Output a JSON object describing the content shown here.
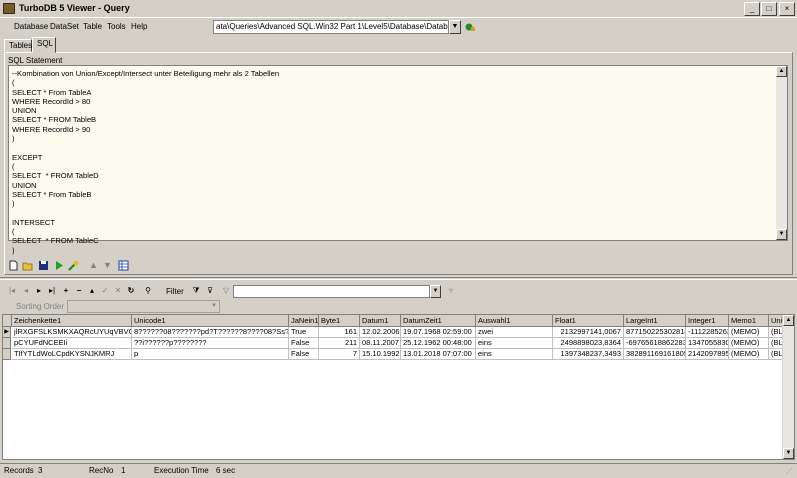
{
  "window": {
    "title": "TurboDB 5 Viewer - Query",
    "minimize_label": "_",
    "maximize_label": "□",
    "close_label": "×"
  },
  "menu": [
    "Database",
    "DataSet",
    "Table",
    "Tools",
    "Help"
  ],
  "path": {
    "value": "ata\\Queries\\Advanced SQL.Win32 Part 1\\Level5\\Database\\Database.tdbd"
  },
  "tabs": [
    "Tables",
    "SQL"
  ],
  "sql": {
    "label": "SQL Statement",
    "text": "--Kombination von Union/Except/Intersect unter Beteiligung mehr als 2 Tabellen\n(\nSELECT * From TableA\nWHERE RecordId > 80\nUNION\nSELECT * FROM TableB\nWHERE RecordId > 90\n)\n\nEXCEPT\n(\nSELECT  * FROM TableD\nUNION\nSELECT * From TableB\n)\n\nINTERSECT\n(\nSELECT  * FROM TableC\n)"
  },
  "nav": {
    "filter_label": "Filter",
    "sort_label": "Sorting Order"
  },
  "grid": {
    "columns": [
      "Zeichenkette1",
      "Unicode1",
      "JaNein1",
      "Byte1",
      "Datum1",
      "DatumZeit1",
      "Auswahl1",
      "Float1",
      "LargeInt1",
      "Integer1",
      "Memo1",
      "Uni"
    ],
    "rows": [
      [
        "jlRXGFSLKSMKXAQRcUYUqVBVG",
        "8??????08???????pd?T??????8????08?Ss?'",
        "True",
        "161",
        "12.02.2006",
        "19.07.1968 02:59:00",
        "zwei",
        "2132997141,0067",
        "8771502253028146",
        "-1112285263",
        "(MEMO)",
        "(BL"
      ],
      [
        "pCYUFdNCEEIi",
        "??i??????p????????",
        "False",
        "211",
        "08.11.2007",
        "25.12.1962 00:48:00",
        "eins",
        "2498898023,8364",
        "-6976561886228381",
        "1347055830",
        "(MEMO)",
        "(BL"
      ],
      [
        "TIfYTLdWoLCpdKYSNJKMRJ",
        "p",
        "False",
        "7",
        "15.10.1992",
        "13.01.2018 07:07:00",
        "eins",
        "1397348237,3493",
        "3828911691618052",
        "2142097895",
        "(MEMO)",
        "(BL"
      ]
    ]
  },
  "status": {
    "records_label": "Records",
    "records_value": "3",
    "recno_label": "RecNo",
    "recno_value": "1",
    "exec_label": "Execution Time",
    "exec_value": "6 sec"
  }
}
